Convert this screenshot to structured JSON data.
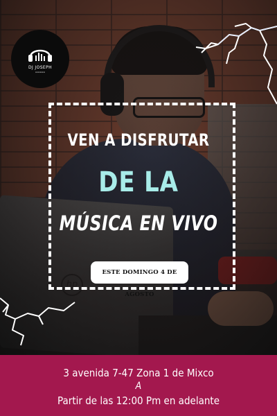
{
  "logo": {
    "brand": "DJ JOSEPH",
    "icon": "headphones-equalizer-icon"
  },
  "headline": {
    "line1": "VEN A DISFRUTAR",
    "line2": "DE LA",
    "line3": "MÚSICA EN VIVO"
  },
  "event": {
    "date": "ESTE DOMINGO 4 DE AGOSTO"
  },
  "photo": {
    "laptop_logo": "hp"
  },
  "footer": {
    "address": "3 avenida 7-47 Zona 1 de Mixco",
    "connector": "A",
    "time": "Partir de las 12:00 Pm en adelante"
  },
  "colors": {
    "band": "#a3184e",
    "accent_text": "#a8ece9",
    "frame": "#ffffff"
  }
}
